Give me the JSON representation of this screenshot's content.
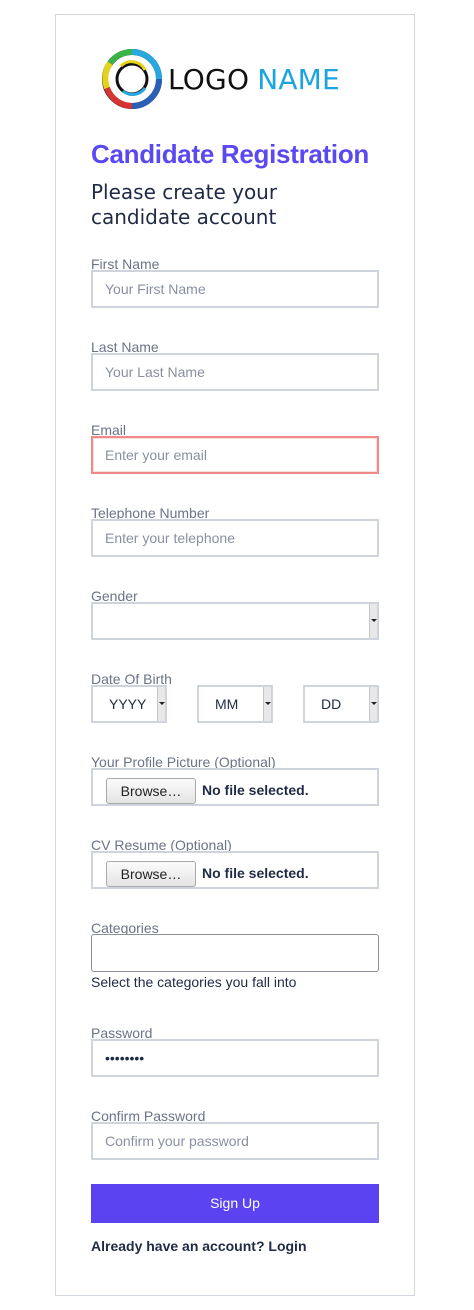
{
  "logo": {
    "word1": "LOGO",
    "word2": "NAME",
    "icon": "ring-logo-icon"
  },
  "header": {
    "title": "Candidate Registration",
    "subtitle": "Please create your candidate account"
  },
  "fields": {
    "first_name": {
      "label": "First Name",
      "placeholder": "Your First Name",
      "value": ""
    },
    "last_name": {
      "label": "Last Name",
      "placeholder": "Your Last Name",
      "value": ""
    },
    "email": {
      "label": "Email",
      "placeholder": "Enter your email",
      "value": ""
    },
    "telephone": {
      "label": "Telephone Number",
      "placeholder": "Enter your telephone",
      "value": ""
    },
    "gender": {
      "label": "Gender",
      "selected": ""
    },
    "dob": {
      "label": "Date Of Birth",
      "year": "YYYY",
      "month": "MM",
      "day": "DD"
    },
    "profile_picture": {
      "label": "Your Profile Picture (Optional)",
      "button": "Browse…",
      "status": "No file selected."
    },
    "cv_resume": {
      "label": "CV Resume (Optional)",
      "button": "Browse…",
      "status": "No file selected."
    },
    "categories": {
      "label": "Categories",
      "value": "",
      "help": "Select the categories you fall into"
    },
    "password": {
      "label": "Password",
      "value": "12345678"
    },
    "confirm_password": {
      "label": "Confirm Password",
      "placeholder": "Confirm your password",
      "value": ""
    }
  },
  "actions": {
    "signup_label": "Sign Up",
    "login_text": "Already have an account? Login"
  },
  "colors": {
    "brand": "#5a48f0",
    "button": "#5b43f2",
    "logo_accent": "#1aa5e0",
    "error_border": "#f08a8a"
  }
}
